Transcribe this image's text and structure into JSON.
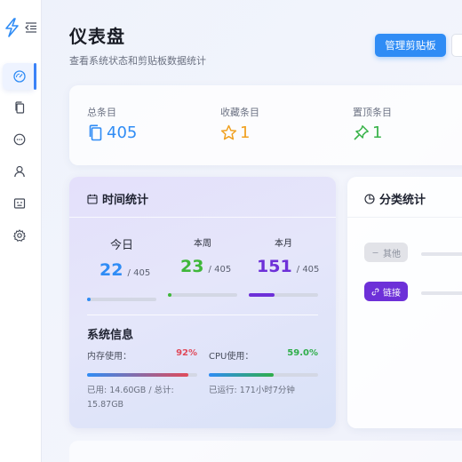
{
  "nav": {
    "items": [
      "dashboard",
      "clipboard",
      "chat",
      "user",
      "robot",
      "settings"
    ]
  },
  "header": {
    "title": "仪表盘",
    "subtitle": "查看系统状态和剪贴板数据统计",
    "manage_button": "管理剪贴板"
  },
  "stats": {
    "total_label": "总条目",
    "total_value": "405",
    "favorites_label": "收藏条目",
    "favorites_value": "1",
    "pinned_label": "置顶条目",
    "pinned_value": "1"
  },
  "time_stats": {
    "title": "时间统计",
    "today": {
      "label": "今日",
      "value": "22",
      "total": "/ 405",
      "progress": 0.054,
      "color": "#2f8cf5"
    },
    "week": {
      "label": "本周",
      "value": "23",
      "total": "/ 405",
      "progress": 0.057,
      "color": "#3fb73a"
    },
    "month": {
      "label": "本月",
      "value": "151",
      "total": "/ 405",
      "progress": 0.373,
      "color": "#6d30d8"
    }
  },
  "system": {
    "title": "系统信息",
    "memory_label": "内存使用：",
    "memory_pct": "92%",
    "memory_progress": 0.92,
    "memory_note": "已用: 14.60GB / 总计: 15.87GB",
    "cpu_label": "CPU使用：",
    "cpu_pct": "59.0%",
    "cpu_progress": 0.59,
    "cpu_note": "已运行: 171小时7分钟"
  },
  "category": {
    "title": "分类统计",
    "other_label": "其他",
    "link_label": "链接"
  },
  "colors": {
    "accent": "#2f8cf5",
    "favorite": "#f0a020",
    "pinned": "#39b34a",
    "memory": "#e04a5a",
    "cpu": "#2fae4a",
    "link_chip": "#6d30d8"
  }
}
